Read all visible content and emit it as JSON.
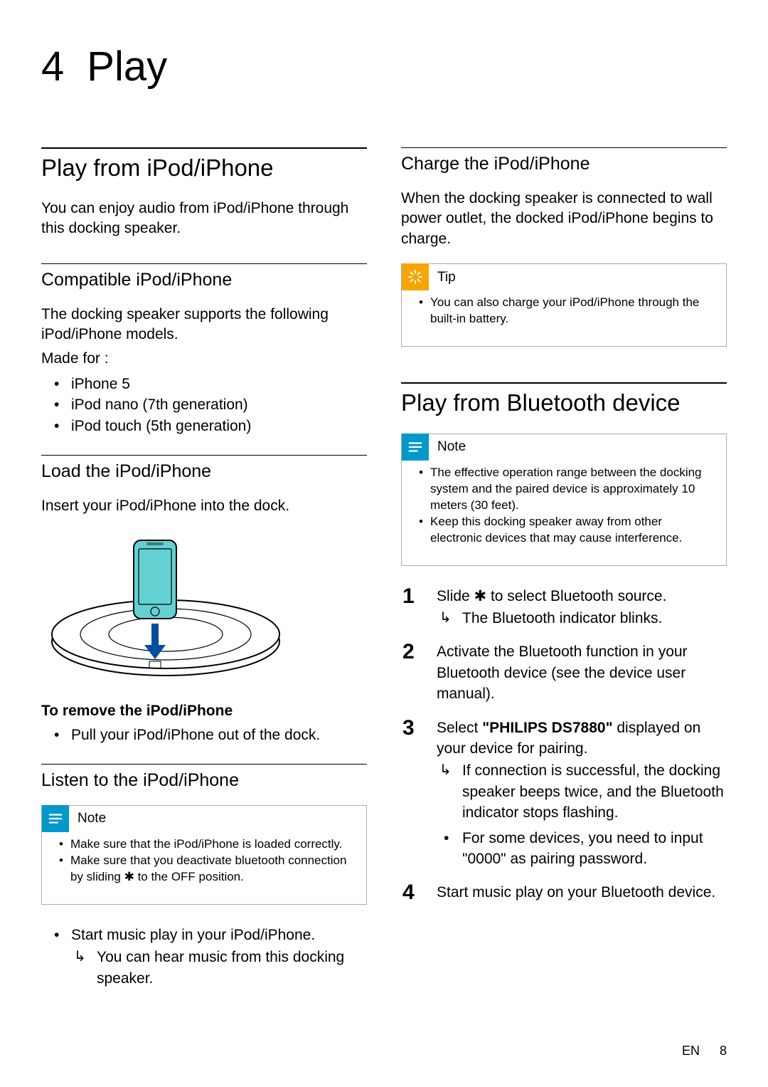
{
  "chapter": {
    "number": "4",
    "title": "Play"
  },
  "left": {
    "h2_play_from": "Play from iPod/iPhone",
    "play_from_p": "You can enjoy audio from iPod/iPhone through this docking speaker.",
    "h3_compatible": "Compatible iPod/iPhone",
    "compatible_p": "The docking speaker supports the following iPod/iPhone models.",
    "made_for": "Made for :",
    "compatible_items": [
      "iPhone 5",
      "iPod nano (7th generation)",
      "iPod touch (5th generation)"
    ],
    "h3_load": "Load the iPod/iPhone",
    "load_p": "Insert your iPod/iPhone into the dock.",
    "remove_title": "To remove the iPod/iPhone",
    "remove_bullet": "Pull your iPod/iPhone out of the dock.",
    "h3_listen": "Listen to the iPod/iPhone",
    "note_label": "Note",
    "listen_notes": [
      "Make sure that the iPod/iPhone is loaded correctly.",
      "Make sure that you deactivate bluetooth connection by sliding ✱ to the OFF position."
    ],
    "listen_start": "Start music play in your iPod/iPhone.",
    "listen_result": "You can hear music from this docking speaker."
  },
  "right": {
    "h3_charge": "Charge the iPod/iPhone",
    "charge_p": "When the docking speaker is connected to wall power outlet, the docked iPod/iPhone begins to charge.",
    "tip_label": "Tip",
    "tip_item": "You can also charge your iPod/iPhone through the built-in battery.",
    "h2_bt": "Play from Bluetooth device",
    "note_label": "Note",
    "bt_notes": [
      "The effective operation range between the docking system and the paired device is approximately 10 meters (30 feet).",
      "Keep this docking speaker away from other electronic devices that may cause interference."
    ],
    "steps": {
      "s1": "Slide ✱ to select Bluetooth source.",
      "s1_result": "The Bluetooth indicator blinks.",
      "s2": "Activate the Bluetooth function in your Bluetooth device (see the device user manual).",
      "s3_pre": "Select ",
      "s3_bold": "\"PHILIPS DS7880\"",
      "s3_post": " displayed on your device for pairing.",
      "s3_result": "If connection is successful, the docking speaker beeps twice, and the Bluetooth indicator stops flashing.",
      "s3_bullet": "For some devices, you need to input \"0000\" as pairing password.",
      "s4": "Start music play on your Bluetooth device."
    }
  },
  "footer": {
    "lang": "EN",
    "page": "8"
  }
}
